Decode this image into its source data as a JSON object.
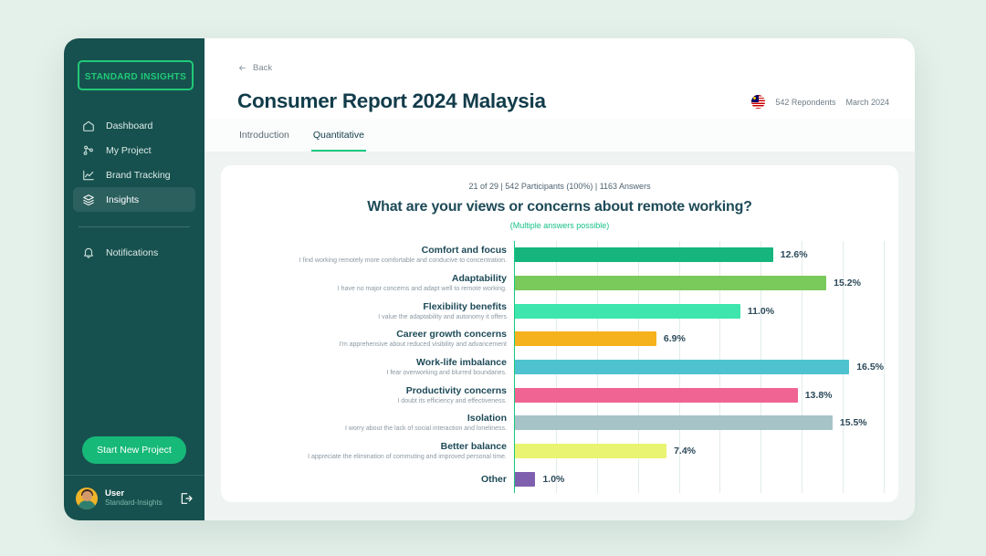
{
  "sidebar": {
    "logo": "STANDARD INSIGHTS",
    "items": [
      {
        "label": "Dashboard",
        "icon": "home-icon"
      },
      {
        "label": "My Project",
        "icon": "project-nodes-icon"
      },
      {
        "label": "Brand Tracking",
        "icon": "line-chart-icon"
      },
      {
        "label": "Insights",
        "icon": "layers-icon"
      }
    ],
    "notifications": {
      "label": "Notifications",
      "icon": "bell-icon"
    },
    "cta_label": "Start New Project",
    "user": {
      "name": "User",
      "org": "Standard-Insights",
      "logout_icon": "logout-icon"
    }
  },
  "header": {
    "back_label": "Back",
    "title": "Consumer Report 2024 Malaysia",
    "flag_icon": "malaysia-flag-icon",
    "respondents": "542 Repondents",
    "period": "March 2024"
  },
  "tabs": [
    {
      "label": "Introduction",
      "active": false
    },
    {
      "label": "Quantitative",
      "active": true
    }
  ],
  "question": {
    "meta": "21 of 29 | 542 Participants (100%) | 1163 Answers",
    "title": "What are your views or concerns about remote working?",
    "subtitle": "(Multiple answers possible)"
  },
  "colors": {
    "brand_green": "#16c97f",
    "sidebar": "#17514f",
    "title": "#123c4a",
    "page_bg": "#e4f0ea"
  },
  "chart_data": {
    "type": "bar",
    "orientation": "horizontal",
    "title": "What are your views or concerns about remote working?",
    "xlabel": "",
    "ylabel": "",
    "xlim": [
      0,
      18
    ],
    "grid": true,
    "legend": "none",
    "categories": [
      "Comfort and focus",
      "Adaptability",
      "Flexibility benefits",
      "Career growth concerns",
      "Work-life imbalance",
      "Productivity concerns",
      "Isolation",
      "Better balance",
      "Other"
    ],
    "sublabels": [
      "I find working remotely more comfortable and conducive to concentration.",
      "I have no major concerns and adapt well to remote working.",
      "I value the adaptability and autonomy it offers",
      "I'm apprehensive about reduced visibility and advancement",
      "I fear overworking and blurred boundaries.",
      "I doubt its efficiency and effectiveness.",
      "I worry about the lack of social interaction and loneliness.",
      "I appreciate the elimination of commuting and improved personal time.",
      ""
    ],
    "values": [
      12.6,
      15.2,
      11.0,
      6.9,
      16.5,
      13.8,
      15.5,
      7.4,
      1.0
    ],
    "value_labels": [
      "12.6%",
      "15.2%",
      "11.0%",
      "6.9%",
      "16.5%",
      "13.8%",
      "15.5%",
      "7.4%",
      "1.0%"
    ],
    "bar_colors": [
      "#16b57d",
      "#7ac95b",
      "#3ee5ac",
      "#f5b21c",
      "#4fc2cf",
      "#ef6493",
      "#a6c3c8",
      "#e9f472",
      "#7f60ae"
    ]
  }
}
